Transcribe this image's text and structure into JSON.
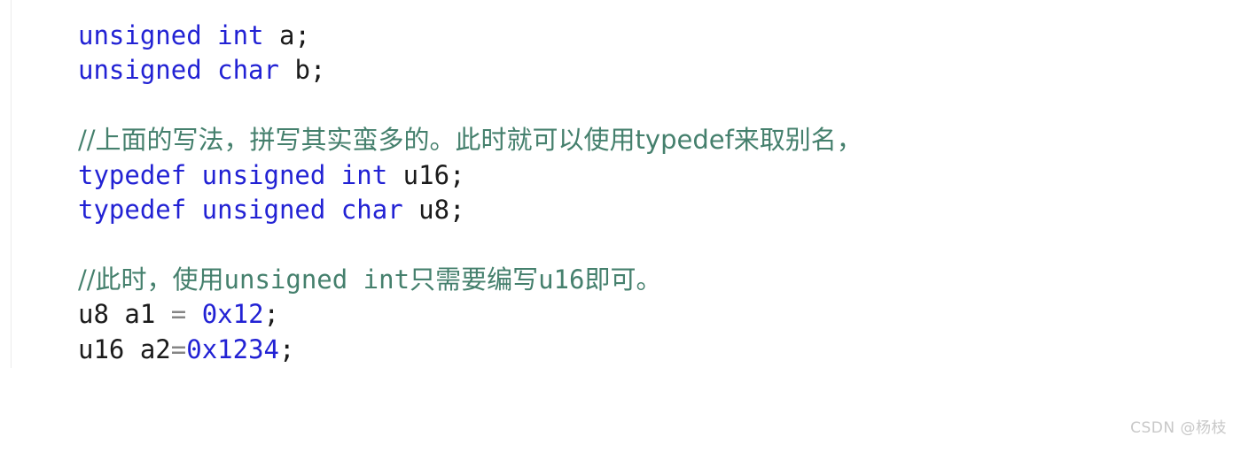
{
  "document": {
    "type": "code-snippet",
    "language": "c",
    "background_color": "#ffffff"
  },
  "colors": {
    "keyword": "#2222d4",
    "identifier": "#1b1b1b",
    "number": "#2222d4",
    "operator": "#858585",
    "comment": "#45806d",
    "gutter_divider": "#ececec",
    "watermark": "#c8c8c8"
  },
  "code": {
    "lines": [
      {
        "index": 1,
        "kind": "code",
        "text": "unsigned int a;",
        "tokens": [
          {
            "type": "keyword",
            "text": "unsigned int"
          },
          {
            "type": "ident",
            "text": " a"
          },
          {
            "type": "punct",
            "text": ";"
          }
        ]
      },
      {
        "index": 2,
        "kind": "code",
        "text": "unsigned char b;",
        "tokens": [
          {
            "type": "keyword",
            "text": "unsigned char"
          },
          {
            "type": "ident",
            "text": " b"
          },
          {
            "type": "punct",
            "text": ";"
          }
        ]
      },
      {
        "index": 3,
        "kind": "blank",
        "text": "",
        "tokens": []
      },
      {
        "index": 4,
        "kind": "comment",
        "text": "//上面的写法，拼写其实蛮多的。此时就可以使用typedef来取别名，",
        "tokens": [
          {
            "type": "comment-cjk",
            "text": "//上面的写法，拼写其实蛮多的。此时就可以使用"
          },
          {
            "type": "comment-latin-sans",
            "text": "typedef"
          },
          {
            "type": "comment-cjk",
            "text": "来取别名，"
          }
        ]
      },
      {
        "index": 5,
        "kind": "code",
        "text": "typedef unsigned int u16;",
        "tokens": [
          {
            "type": "keyword",
            "text": "typedef unsigned int"
          },
          {
            "type": "ident",
            "text": " u16"
          },
          {
            "type": "punct",
            "text": ";"
          }
        ]
      },
      {
        "index": 6,
        "kind": "code",
        "text": "typedef unsigned char u8;",
        "tokens": [
          {
            "type": "keyword",
            "text": "typedef unsigned char"
          },
          {
            "type": "ident",
            "text": " u8"
          },
          {
            "type": "punct",
            "text": ";"
          }
        ]
      },
      {
        "index": 7,
        "kind": "blank",
        "text": "",
        "tokens": []
      },
      {
        "index": 8,
        "kind": "comment",
        "text": "//此时，使用unsigned int只需要编写u16即可。",
        "tokens": [
          {
            "type": "comment-cjk",
            "text": "//此时，使用"
          },
          {
            "type": "comment-latin-mono",
            "text": "unsigned int"
          },
          {
            "type": "comment-cjk",
            "text": "只需要编写"
          },
          {
            "type": "comment-latin-mono",
            "text": "u16"
          },
          {
            "type": "comment-cjk",
            "text": "即可。"
          }
        ]
      },
      {
        "index": 9,
        "kind": "code",
        "text": "u8 a1 = 0x12;",
        "tokens": [
          {
            "type": "ident",
            "text": "u8 a1 "
          },
          {
            "type": "op",
            "text": "="
          },
          {
            "type": "ident",
            "text": " "
          },
          {
            "type": "number",
            "text": "0x12"
          },
          {
            "type": "punct",
            "text": ";"
          }
        ]
      },
      {
        "index": 10,
        "kind": "code",
        "text": "u16 a2=0x1234;",
        "tokens": [
          {
            "type": "ident",
            "text": "u16 a2"
          },
          {
            "type": "op",
            "text": "="
          },
          {
            "type": "number",
            "text": "0x1234"
          },
          {
            "type": "punct",
            "text": ";"
          }
        ]
      }
    ]
  },
  "watermark": {
    "text": "CSDN @杨枝"
  }
}
